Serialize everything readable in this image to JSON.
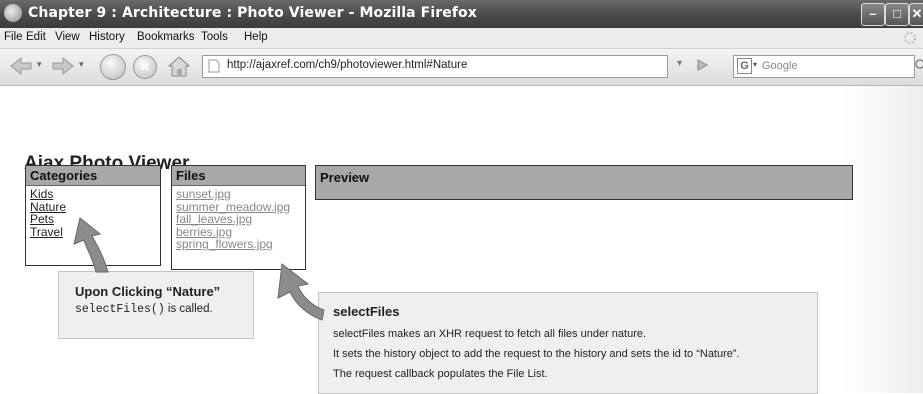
{
  "window": {
    "title": "Chapter 9 : Architecture : Photo Viewer - Mozilla Firefox"
  },
  "menu": {
    "items": [
      "File",
      "Edit",
      "View",
      "History",
      "Bookmarks",
      "Tools",
      "Help"
    ]
  },
  "toolbar": {
    "url": "http://ajaxref.com/ch9/photoviewer.html#Nature",
    "search_placeholder": "Google",
    "search_engine_letter": "G"
  },
  "page": {
    "title": "Ajax Photo Viewer",
    "categories": {
      "header": "Categories",
      "items": [
        "Kids",
        "Nature",
        "Pets",
        "Travel"
      ]
    },
    "files": {
      "header": "Files",
      "items": [
        "sunset.jpg",
        "summer_meadow.jpg",
        "fall_leaves.jpg",
        "berries.jpg",
        "spring_flowers.jpg"
      ]
    },
    "preview": {
      "header": "Preview"
    }
  },
  "callouts": {
    "click": {
      "title": "Upon Clicking “Nature”",
      "code": "selectFiles()",
      "suffix": " is called."
    },
    "select": {
      "title": "selectFiles",
      "lines": [
        "selectFiles makes an XHR request to fetch all files under nature.",
        "It sets the history object to add the request to the history and sets the id to “Nature”.",
        "The request callback populates the File List."
      ]
    }
  },
  "colors": {
    "header_gray": "#a8a8a8",
    "callout_bg": "#efefef",
    "titlebar": "#4a4a4a"
  }
}
